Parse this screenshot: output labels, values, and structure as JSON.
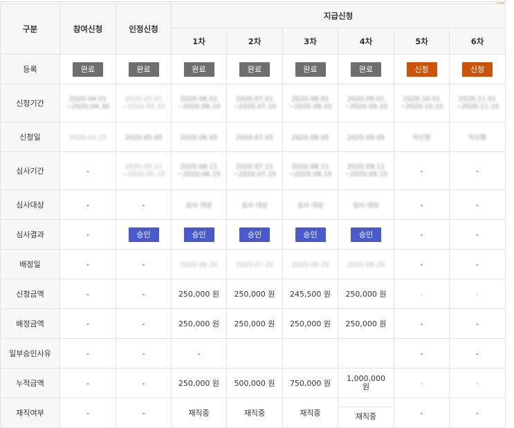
{
  "headers": {
    "division": "구분",
    "participation": "참여신청",
    "certification": "인정신청",
    "payment": "지급신청",
    "rounds": [
      "1차",
      "2차",
      "3차",
      "4차",
      "5차",
      "6차"
    ]
  },
  "rows": {
    "registration": {
      "label": "등록",
      "buttons": [
        "완료",
        "완료",
        "완료",
        "완료",
        "완료",
        "완료",
        "신청",
        "신청"
      ]
    },
    "application_period": {
      "label": "신청기간",
      "cells": [
        "2020.04.01\n~2020.04.30",
        "2020.05.01\n~2020.05.10",
        "2020.06.01\n~2020.06.10",
        "2020.07.01\n~2020.07.10",
        "2020.08.01\n~2020.08.10",
        "2020.09.01\n~2020.09.10",
        "2020.10.01\n~2020.10.10",
        "2020.11.01\n~2020.11.10"
      ]
    },
    "application_date": {
      "label": "신청일",
      "cells": [
        "2020.04.15",
        "2020.05.05",
        "2020.06.05",
        "2020.07.05",
        "2020.08.05",
        "2020.09.05",
        "미신청",
        "미신청"
      ]
    },
    "review_period": {
      "label": "심사기간",
      "cells": [
        "-",
        "2020.05.11\n~2020.05.15",
        "2020.06.11\n~2020.06.15",
        "2020.07.11\n~2020.07.15",
        "2020.08.11\n~2020.08.15",
        "2020.09.11\n~2020.09.15",
        "-",
        "-"
      ]
    },
    "review_target": {
      "label": "심사대상",
      "cells": [
        "-",
        "-",
        "심사 대상",
        "심사 대상",
        "심사 대상",
        "심사 대상",
        "-",
        "-"
      ]
    },
    "review_result": {
      "label": "심사결과",
      "cells": [
        "-",
        "승인",
        "승인",
        "승인",
        "승인",
        "승인",
        "-",
        "-"
      ]
    },
    "allocation_date": {
      "label": "배정일",
      "cells": [
        "-",
        "-",
        "2020.06.20",
        "2020.07.20",
        "2020.08.20",
        "2020.09.20",
        "-",
        "-"
      ]
    },
    "requested_amount": {
      "label": "신청금액",
      "cells": [
        "-",
        "-",
        "250,000 원",
        "250,000 원",
        "245,500 원",
        "250,000 원",
        "-",
        "-"
      ]
    },
    "allocated_amount": {
      "label": "배정금액",
      "cells": [
        "-",
        "-",
        "250,000 원",
        "250,000 원",
        "250,000 원",
        "250,000 원",
        "-",
        "-"
      ]
    },
    "partial_reason": {
      "label": "일부승인사유",
      "cells": [
        "-",
        "-",
        "-",
        "",
        "",
        "",
        "-",
        "-"
      ]
    },
    "cumulative_amount": {
      "label": "누적금액",
      "cells": [
        "-",
        "-",
        "250,000 원",
        "500,000 원",
        "750,000 원",
        "1,000,000\n원",
        "-",
        "-"
      ]
    },
    "employment_status": {
      "label": "재직여부",
      "cells": [
        "-",
        "-",
        "재직중",
        "재직중",
        "재직중",
        "재직중",
        "-",
        "-"
      ]
    }
  },
  "colors": {
    "complete_button": "#6e6e6e",
    "apply_button": "#cc5207",
    "approve_button": "#4a5acb",
    "requested_amount_text": "#d0702a",
    "cumulative_amount_text": "#2d8ac9",
    "header_background": "#f7f7f7",
    "border": "#e3e3e3"
  }
}
